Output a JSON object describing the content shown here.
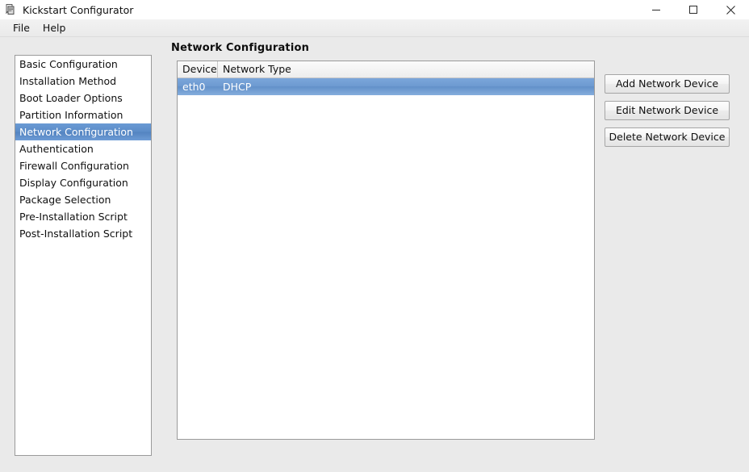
{
  "window": {
    "title": "Kickstart Configurator",
    "icon": "app-icon",
    "controls": {
      "minimize": "minimize-icon",
      "maximize": "maximize-icon",
      "close": "close-icon"
    }
  },
  "menubar": {
    "items": [
      {
        "label": "File"
      },
      {
        "label": "Help"
      }
    ]
  },
  "sidebar": {
    "selected_index": 4,
    "items": [
      {
        "label": "Basic Configuration"
      },
      {
        "label": "Installation Method"
      },
      {
        "label": "Boot Loader Options"
      },
      {
        "label": "Partition Information"
      },
      {
        "label": "Network Configuration"
      },
      {
        "label": "Authentication"
      },
      {
        "label": "Firewall Configuration"
      },
      {
        "label": "Display Configuration"
      },
      {
        "label": "Package Selection"
      },
      {
        "label": "Pre-Installation Script"
      },
      {
        "label": "Post-Installation Script"
      }
    ]
  },
  "main": {
    "heading": "Network Configuration",
    "table": {
      "columns": [
        {
          "label": "Device"
        },
        {
          "label": "Network Type"
        }
      ],
      "rows": [
        {
          "device": "eth0",
          "network_type": "DHCP",
          "selected": true
        }
      ]
    },
    "buttons": [
      {
        "label": "Add Network Device"
      },
      {
        "label": "Edit Network Device"
      },
      {
        "label": "Delete Network Device"
      }
    ]
  },
  "colors": {
    "background": "#eaeaea",
    "panel": "#ffffff",
    "selection_blue": "#5b8cc8",
    "row_selection_blue": "#6d9ad1",
    "border": "#9a9a9a",
    "text": "#101010"
  }
}
